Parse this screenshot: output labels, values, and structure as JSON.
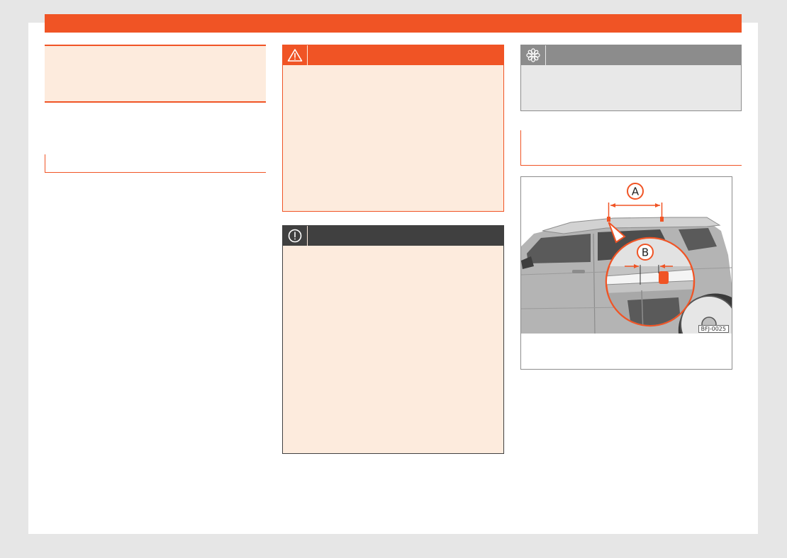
{
  "figure": {
    "callouts": [
      "A",
      "B"
    ],
    "code": "BFJ-0025"
  },
  "icons": {
    "warning": "warning-triangle-icon",
    "notice": "exclamation-circle-icon",
    "environment": "flower-icon"
  },
  "colors": {
    "accent": "#f05425",
    "accent_light": "#fdebdd",
    "notice_dark": "#404040",
    "env_gray": "#8c8c8c"
  }
}
